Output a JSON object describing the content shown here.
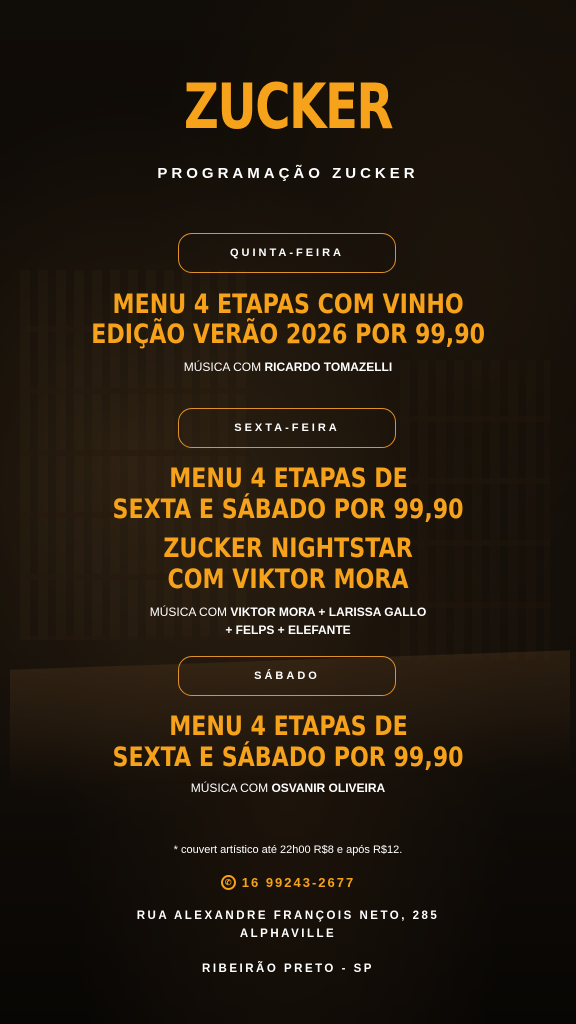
{
  "brand": {
    "logo": "ZUCKER",
    "subtitle": "PROGRAMAÇÃO ZUCKER",
    "accent_color": "#f6a21a"
  },
  "days": [
    {
      "label": "QUINTA-FEIRA",
      "headlines": [
        "MENU 4 ETAPAS COM VINHO",
        "EDIÇÃO VERÃO 2026 POR 99,90"
      ],
      "music_prefix": "MÚSICA COM ",
      "music_artists": "RICARDO TOMAZELLI"
    },
    {
      "label": "SEXTA-FEIRA",
      "headlines": [
        "MENU 4 ETAPAS DE",
        "SEXTA E SÁBADO POR 99,90",
        "ZUCKER NIGHTSTAR",
        "COM VIKTOR MORA"
      ],
      "music_prefix": "MÚSICA COM ",
      "music_artists": "VIKTOR MORA + LARISSA GALLO",
      "music_artists_2": "+ FELPS + ELEFANTE"
    },
    {
      "label": "SÁBADO",
      "headlines": [
        "MENU 4 ETAPAS DE",
        "SEXTA E SÁBADO POR 99,90"
      ],
      "music_prefix": "MÚSICA COM ",
      "music_artists": "OSVANIR OLIVEIRA"
    }
  ],
  "footer": {
    "couvert_note": "* couvert artístico até 22h00 R$8 e após R$12.",
    "phone": "16 99243-2677",
    "phone_icon": "whatsapp-icon",
    "address_line1": "RUA ALEXANDRE FRANÇOIS NETO, 285",
    "address_line2": "ALPHAVILLE",
    "city": "RIBEIRÃO PRETO - SP"
  }
}
